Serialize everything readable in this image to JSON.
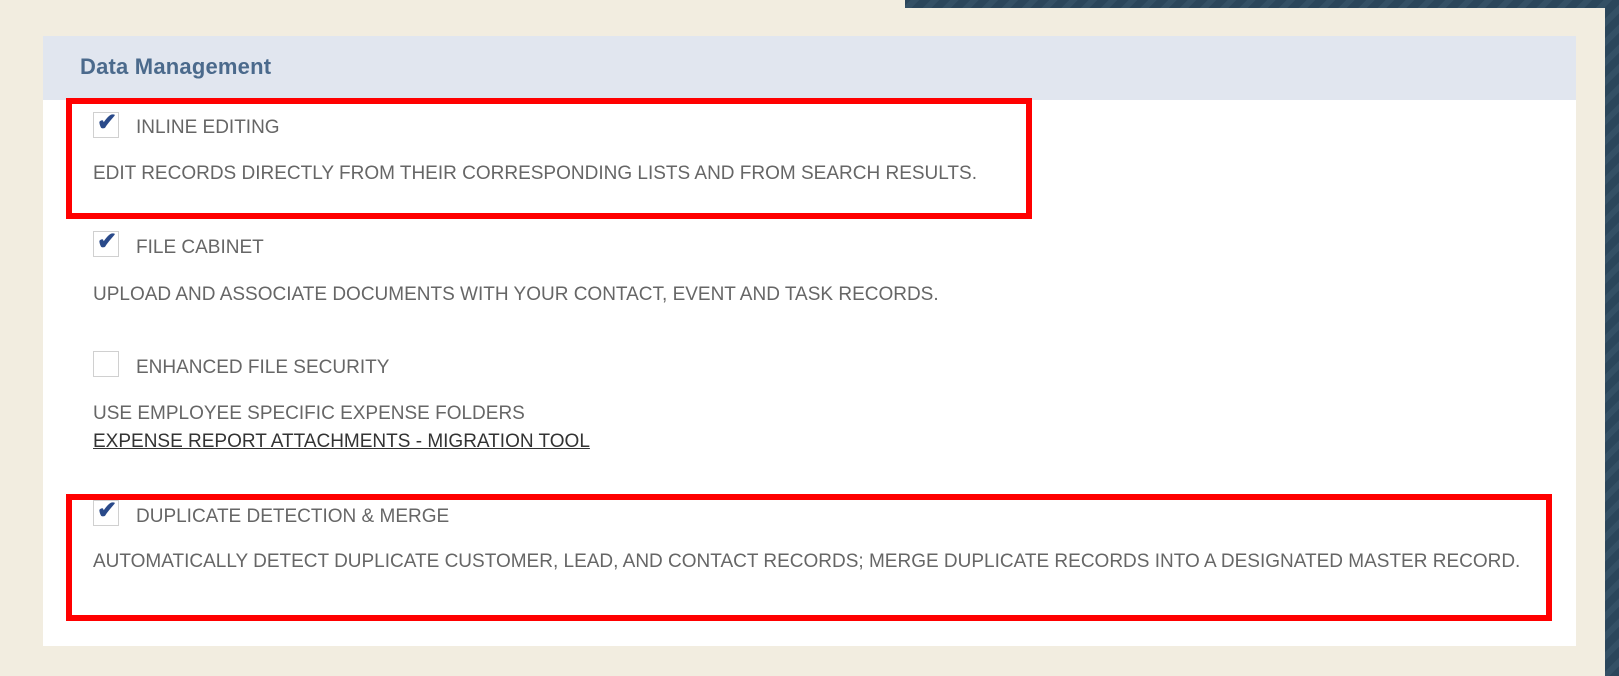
{
  "section": {
    "title": "Data Management"
  },
  "options": [
    {
      "label": "INLINE EDITING",
      "checked": true,
      "description": "EDIT RECORDS DIRECTLY FROM THEIR CORRESPONDING LISTS AND FROM SEARCH RESULTS.",
      "highlighted": true
    },
    {
      "label": "FILE CABINET",
      "checked": true,
      "description": "UPLOAD AND ASSOCIATE DOCUMENTS WITH YOUR CONTACT, EVENT AND TASK RECORDS.",
      "highlighted": false
    },
    {
      "label": "ENHANCED FILE SECURITY",
      "checked": false,
      "description": "USE EMPLOYEE SPECIFIC EXPENSE FOLDERS",
      "link": "EXPENSE REPORT ATTACHMENTS - MIGRATION TOOL",
      "highlighted": false
    },
    {
      "label": "DUPLICATE DETECTION & MERGE",
      "checked": true,
      "description": "AUTOMATICALLY DETECT DUPLICATE CUSTOMER, LEAD, AND CONTACT RECORDS; MERGE DUPLICATE RECORDS INTO A DESIGNATED MASTER RECORD.",
      "highlighted": true
    }
  ],
  "colors": {
    "header_bg": "#e1e6ef",
    "title_text": "#4b6a8c",
    "highlight_border": "#ff0000",
    "check_color": "#2a4a8a",
    "page_bg": "#f2ede0"
  }
}
